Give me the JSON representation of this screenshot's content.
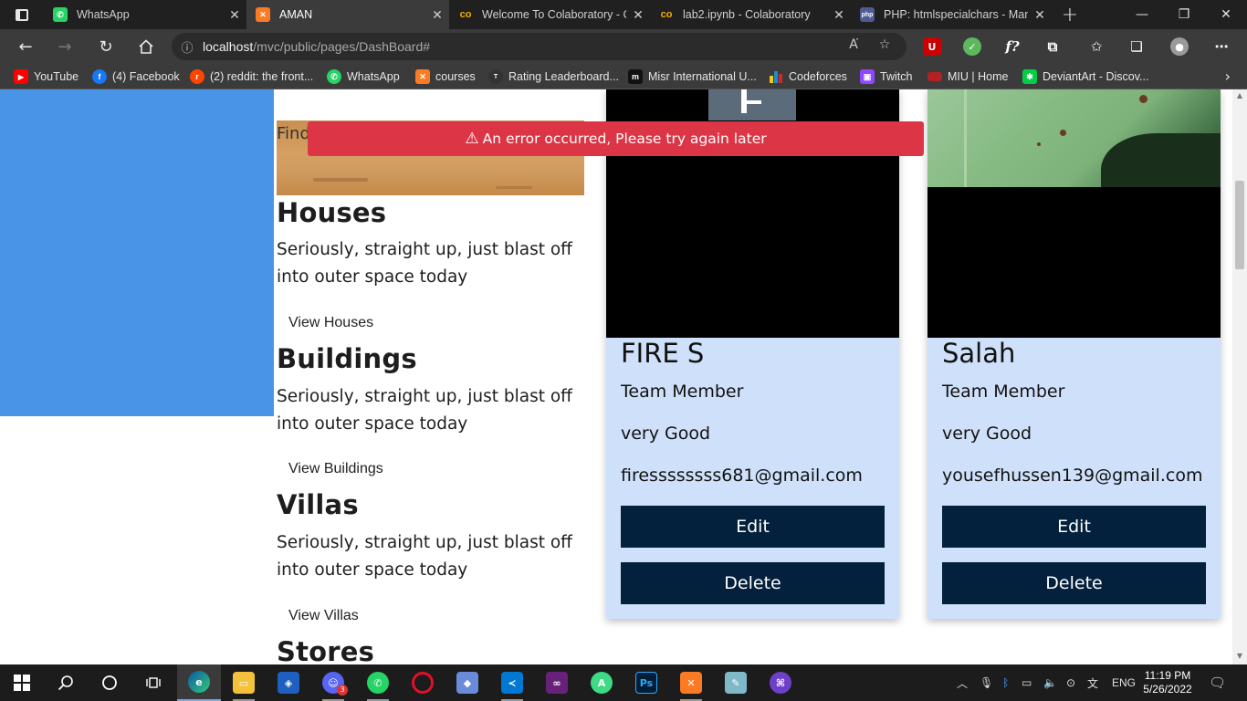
{
  "browser": {
    "tabs": [
      {
        "title": "WhatsApp",
        "icon": "whatsapp-icon",
        "color": "#25d366",
        "glyph": "✆"
      },
      {
        "title": "AMAN",
        "icon": "xampp-icon",
        "color": "#fb7a24",
        "glyph": "✕",
        "active": true
      },
      {
        "title": "Welcome To Colaboratory - C",
        "icon": "colab-icon",
        "color": "#f9ab00",
        "glyph": "co"
      },
      {
        "title": "lab2.ipynb - Colaboratory",
        "icon": "colab-icon",
        "color": "#f9ab00",
        "glyph": "co"
      },
      {
        "title": "PHP: htmlspecialchars - Manu",
        "icon": "php-icon",
        "color": "#4f5b93",
        "glyph": "php"
      }
    ],
    "new_tab": "+",
    "window_controls": {
      "minimize": "—",
      "restore": "❐",
      "close": "✕"
    },
    "url_host": "localhost",
    "url_path": "/mvc/public/pages/DashBoard#",
    "bookmarks": [
      {
        "label": "YouTube",
        "icon": "youtube-icon",
        "color": "#ff0000",
        "glyph": "▶"
      },
      {
        "label": "(4) Facebook",
        "icon": "facebook-icon",
        "color": "#1877f2",
        "glyph": "f"
      },
      {
        "label": "(2) reddit: the front...",
        "icon": "reddit-icon",
        "color": "#ff4500",
        "glyph": "r"
      },
      {
        "label": "WhatsApp",
        "icon": "whatsapp-icon",
        "color": "#25d366",
        "glyph": "✆"
      },
      {
        "label": "courses",
        "icon": "xampp-icon",
        "color": "#fb7a24",
        "glyph": "✕"
      },
      {
        "label": "Rating Leaderboard...",
        "icon": "tmdb-icon",
        "color": "#333333",
        "glyph": "T"
      },
      {
        "label": "Misr International U...",
        "icon": "miu-icon",
        "color": "#111111",
        "glyph": "m"
      },
      {
        "label": "Codeforces",
        "icon": "codeforces-icon",
        "color": "#1f8acb",
        "glyph": "▮"
      },
      {
        "label": "Twitch",
        "icon": "twitch-icon",
        "color": "#9146ff",
        "glyph": "▣"
      },
      {
        "label": "MIU | Home",
        "icon": "miu-home-icon",
        "color": "#b22222",
        "glyph": "▬"
      },
      {
        "label": "DeviantArt - Discov...",
        "icon": "deviantart-icon",
        "color": "#05cc47",
        "glyph": "✱"
      }
    ]
  },
  "page": {
    "cut_heading": "",
    "banner_text": "Find",
    "categories": [
      {
        "title": "Houses",
        "desc": "Seriously, straight up, just blast off into outer space today",
        "link": "View Houses"
      },
      {
        "title": "Buildings",
        "desc": "Seriously, straight up, just blast off into outer space today",
        "link": "View Buildings"
      },
      {
        "title": "Villas",
        "desc": "Seriously, straight up, just blast off into outer space today",
        "link": "View Villas"
      },
      {
        "title": "Stores"
      }
    ],
    "alert": {
      "message": "An error occurred, Please try again later",
      "color": "#dc3545"
    },
    "team": [
      {
        "name": "FIRE S",
        "role": "Team Member",
        "review": "very Good",
        "email": "firessssssss681@gmail.com",
        "edit": "Edit",
        "delete": "Delete"
      },
      {
        "name": "Salah",
        "role": "Team Member",
        "review": "very Good",
        "email": "yousefhussen139@gmail.com",
        "edit": "Edit",
        "delete": "Delete"
      }
    ]
  },
  "taskbar": {
    "time": "11:19 PM",
    "date": "5/26/2022",
    "lang": "ENG",
    "notification_count": "3"
  }
}
